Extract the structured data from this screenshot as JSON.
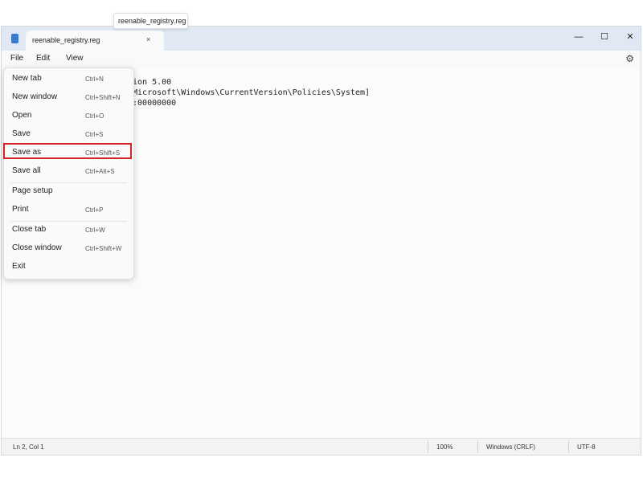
{
  "window": {
    "tab_title": "reenable_registry.reg",
    "tab_close": "×",
    "tooltip": "reenable_registry.reg",
    "controls": {
      "minimize": "—",
      "maximize": "☐",
      "close": "✕"
    }
  },
  "menu": {
    "file": "File",
    "edit": "Edit",
    "view": "View"
  },
  "editor": {
    "lines": [
      "sion 5.00",
      "\\Microsoft\\Windows\\CurrentVersion\\Policies\\System]",
      "d:00000000"
    ]
  },
  "file_menu": {
    "items": [
      {
        "label": "New tab",
        "shortcut": "Ctrl+N"
      },
      {
        "label": "New window",
        "shortcut": "Ctrl+Shift+N"
      },
      {
        "label": "Open",
        "shortcut": "Ctrl+O"
      },
      {
        "label": "Save",
        "shortcut": "Ctrl+S"
      },
      {
        "label": "Save as",
        "shortcut": "Ctrl+Shift+S"
      },
      {
        "label": "Save all",
        "shortcut": "Ctrl+Alt+S"
      },
      {
        "label": "Page setup",
        "shortcut": ""
      },
      {
        "label": "Print",
        "shortcut": "Ctrl+P"
      },
      {
        "label": "Close tab",
        "shortcut": "Ctrl+W"
      },
      {
        "label": "Close window",
        "shortcut": "Ctrl+Shift+W"
      },
      {
        "label": "Exit",
        "shortcut": ""
      }
    ]
  },
  "status": {
    "position": "Ln 2, Col 1",
    "zoom": "100%",
    "line_ending": "Windows (CRLF)",
    "encoding": "UTF-8"
  },
  "colors": {
    "titlebar": "#dfe8f3",
    "highlight": "#d2232a"
  }
}
